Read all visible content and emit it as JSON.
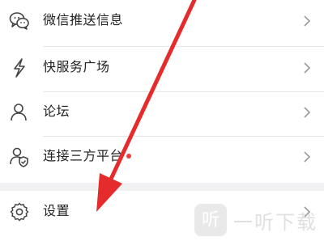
{
  "menu": {
    "items": [
      {
        "label": "微信推送信息",
        "icon": "wechat-icon"
      },
      {
        "label": "快服务广场",
        "icon": "lightning-icon"
      },
      {
        "label": "论坛",
        "icon": "user-icon"
      },
      {
        "label": "连接三方平台",
        "icon": "shield-user-icon",
        "has_badge_dot": true
      }
    ],
    "settings": {
      "label": "设置",
      "icon": "gear-icon"
    }
  },
  "overlay": {
    "arrow_color": "#e52b2b",
    "badge_dot_color": "#ef3c3c"
  },
  "watermark": {
    "text": "一听下载",
    "logo_glyph": "听"
  }
}
